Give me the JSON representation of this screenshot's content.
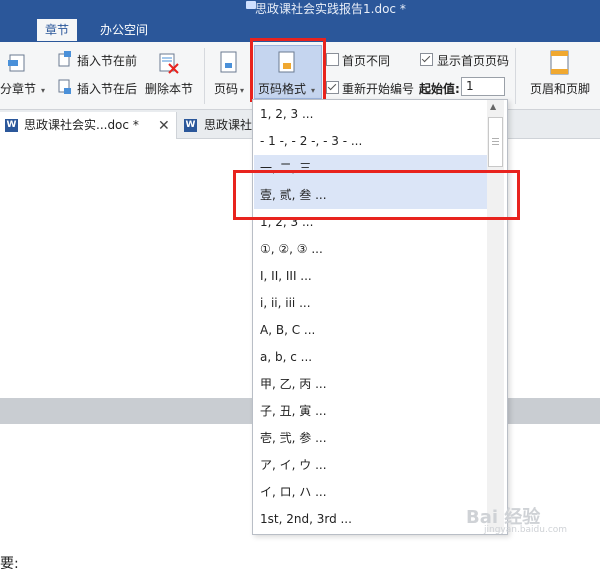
{
  "window": {
    "title": "思政课社会实践报告1.doc *"
  },
  "menu_tabs": [
    "章节",
    "办公空间"
  ],
  "ribbon": {
    "split_section": "拆分章节",
    "insert_before": "插入节在前",
    "insert_after": "插入节在后",
    "delete_section": "删除本节",
    "page_number": "页码",
    "page_number_format": "页码格式",
    "first_page_different": "首页不同",
    "show_first_page_number": "显示首页页码",
    "restart_numbering": "重新开始编号",
    "start_value_label": "起始值:",
    "start_value": "1",
    "header_footer": "页眉和页脚",
    "first_page_different_checked": false,
    "show_first_page_number_checked": true,
    "restart_numbering_checked": true
  },
  "doc_tabs": [
    {
      "label": "思政课社会实...doc *",
      "active": true
    },
    {
      "label": "思政课社"
    }
  ],
  "page_number_formats": [
    "1, 2, 3 ...",
    "- 1 -, - 2 -, - 3 - ...",
    "一, 二, 三 ...",
    "壹, 贰, 叁 ...",
    "1, 2, 3 ...",
    "①, ②, ③ ...",
    "I, II, III ...",
    "i, ii, iii ...",
    "A, B, C ...",
    "a, b, c ...",
    "甲, 乙, 丙 ...",
    "子, 丑, 寅 ...",
    "壱, 弐, 参 ...",
    "ア, イ, ウ ...",
    "イ, ロ, ハ ...",
    "1st, 2nd, 3rd ..."
  ],
  "document_text": "要:",
  "watermark": {
    "text": "Bai 经验",
    "url": "jingyan.baidu.com"
  },
  "colors": {
    "titlebar": "#2b579a",
    "highlight_red": "#e8231e",
    "selection": "#dbe5f7"
  }
}
